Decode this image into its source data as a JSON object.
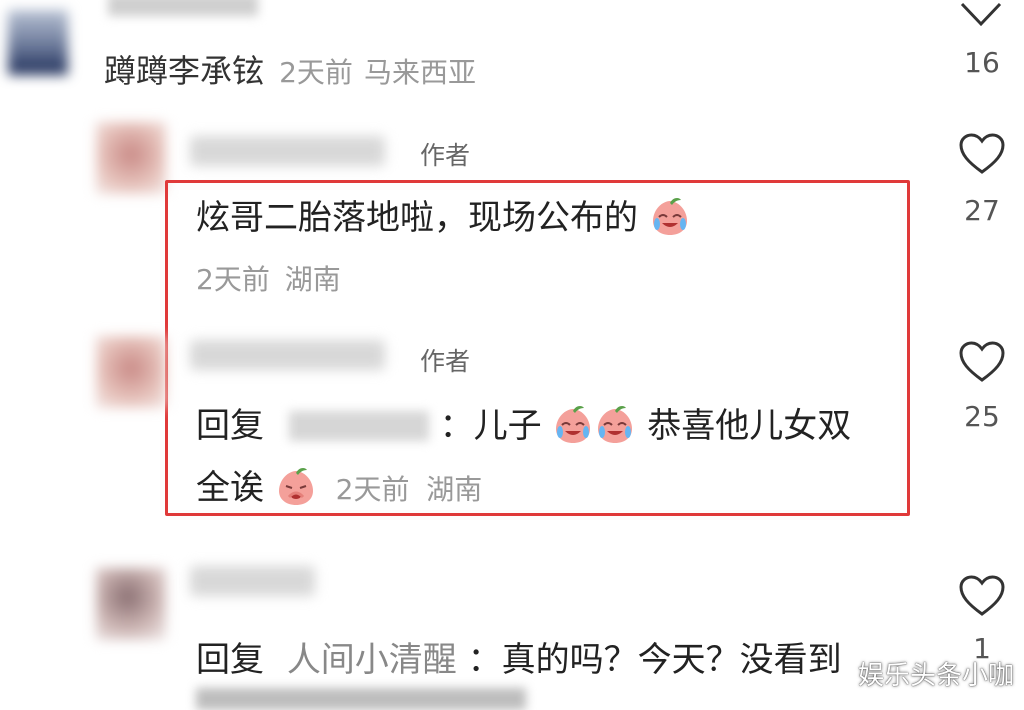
{
  "comments": [
    {
      "username": "蹲蹲李承铉",
      "time": "2天前",
      "location": "马来西亚",
      "likes": "16"
    },
    {
      "badge": "作者",
      "text": "炫哥二胎落地啦，现场公布的",
      "time": "2天前",
      "location": "湖南",
      "likes": "27"
    },
    {
      "badge": "作者",
      "reply_prefix": "回复",
      "reply_text_1": "：儿子",
      "reply_text_2": "恭喜他儿女双",
      "reply_text_3": "全诶",
      "time": "2天前",
      "location": "湖南",
      "likes": "25"
    },
    {
      "reply_prefix": "回复",
      "reply_target": "人间小清醒",
      "reply_text": "：真的吗？今天？没看到",
      "likes": "1"
    }
  ],
  "watermark": "娱乐头条小咖",
  "icons": {
    "collapse": "chevron-down-icon",
    "like": "heart-outline-icon",
    "emoji": "crying-laughing-peach-emoji"
  },
  "colors": {
    "highlight_border": "#e03a3a",
    "meta_text": "#999999"
  }
}
